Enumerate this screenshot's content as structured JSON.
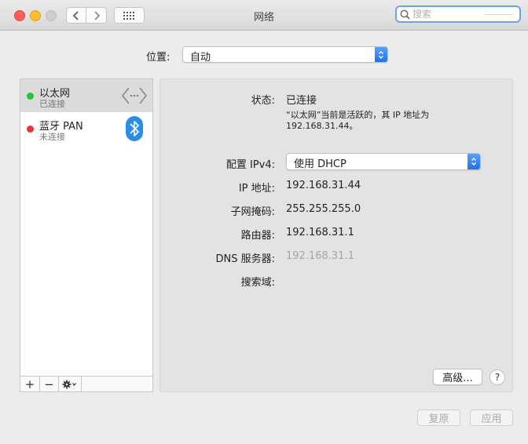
{
  "window": {
    "title": "网络"
  },
  "search": {
    "placeholder": "搜索",
    "value": ""
  },
  "location": {
    "label": "位置:",
    "value": "自动"
  },
  "services": [
    {
      "name": "以太网",
      "status": "已连接",
      "status_color": "#29c13b",
      "icon": "ethernet-arrows-icon"
    },
    {
      "name": "蓝牙 PAN",
      "status": "未连接",
      "status_color": "#e8343b",
      "icon": "bluetooth-icon"
    }
  ],
  "list_toolbar": {
    "add": "+",
    "remove": "−"
  },
  "detail": {
    "status_label": "状态:",
    "status_value": "已连接",
    "status_desc": "“以太网”当前是活跃的，其 IP 地址为 192.168.31.44。",
    "ipv4_label": "配置 IPv4:",
    "ipv4_value": "使用 DHCP",
    "ip_label": "IP 地址:",
    "ip_value": "192.168.31.44",
    "subnet_label": "子网掩码:",
    "subnet_value": "255.255.255.0",
    "router_label": "路由器:",
    "router_value": "192.168.31.1",
    "dns_label": "DNS 服务器:",
    "dns_value": "192.168.31.1",
    "search_domain_label": "搜索域:"
  },
  "buttons": {
    "advanced": "高级...",
    "help": "?",
    "revert": "复原",
    "apply": "应用"
  }
}
